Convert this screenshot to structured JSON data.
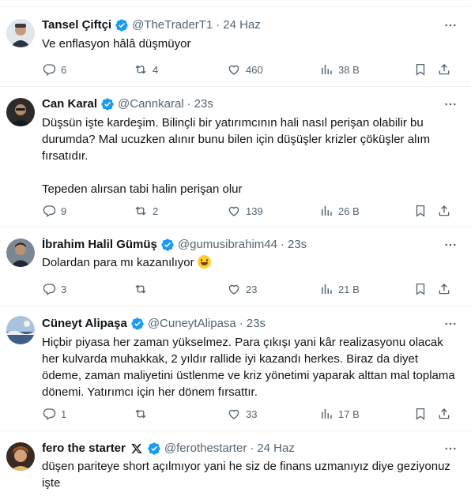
{
  "tweets": [
    {
      "name": "Tansel Çiftçi",
      "handle": "@TheTraderT1",
      "time": "24 Haz",
      "text": "Ve enflasyon hâlâ düşmüyor",
      "replies": "6",
      "reposts": "4",
      "likes": "460",
      "views": "38 B",
      "avatar_color": "#6b7c8c"
    },
    {
      "name": "Can Karal",
      "handle": "@Cannkaral",
      "time": "23s",
      "text": "Düşsün işte kardeşim. Bilinçli bir yatırımcının hali nasıl perişan olabilir bu durumda? Mal ucuzken alınır bunu bilen için düşüşler krizler çöküşler alım fırsatıdır.\n\nTepeden alırsan tabi halin perişan olur",
      "replies": "9",
      "reposts": "2",
      "likes": "139",
      "views": "26 B",
      "avatar_color": "#3a3530"
    },
    {
      "name": "İbrahim Halil Gümüş",
      "handle": "@gumusibrahim44",
      "time": "23s",
      "text": "Dolardan para mı kazanılıyor",
      "emoji": "grinning-face-emoji",
      "replies": "3",
      "reposts": "",
      "likes": "23",
      "views": "21 B",
      "avatar_color": "#5a6470"
    },
    {
      "name": "Cüneyt Alipaşa",
      "handle": "@CuneytAlipasa",
      "time": "23s",
      "text": "Hiçbir piyasa her zaman yükselmez. Para çıkışı yani kâr realizasyonu olacak her kulvarda muhakkak, 2 yıldır rallide iyi kazandı herkes. Biraz da diyet ödeme, zaman maliyetini üstlenme ve kriz yönetimi yaparak alttan mal toplama dönemi. Yatırımcı için her dönem fırsattır.",
      "replies": "1",
      "reposts": "",
      "likes": "33",
      "views": "17 B",
      "avatar_color": "#8fb0cf"
    },
    {
      "name": "fero the starter",
      "handle": "@ferothestarter",
      "time": "24 Haz",
      "text": "düşen pariteye short açılmıyor yani he siz de finans uzmanıyız diye geziyonuz işte",
      "avatar_color": "#c9954f"
    }
  ],
  "colors": {
    "verified": "#1d9bf0",
    "muted": "#536471",
    "text": "#0f1419",
    "divider": "#eff3f4"
  }
}
